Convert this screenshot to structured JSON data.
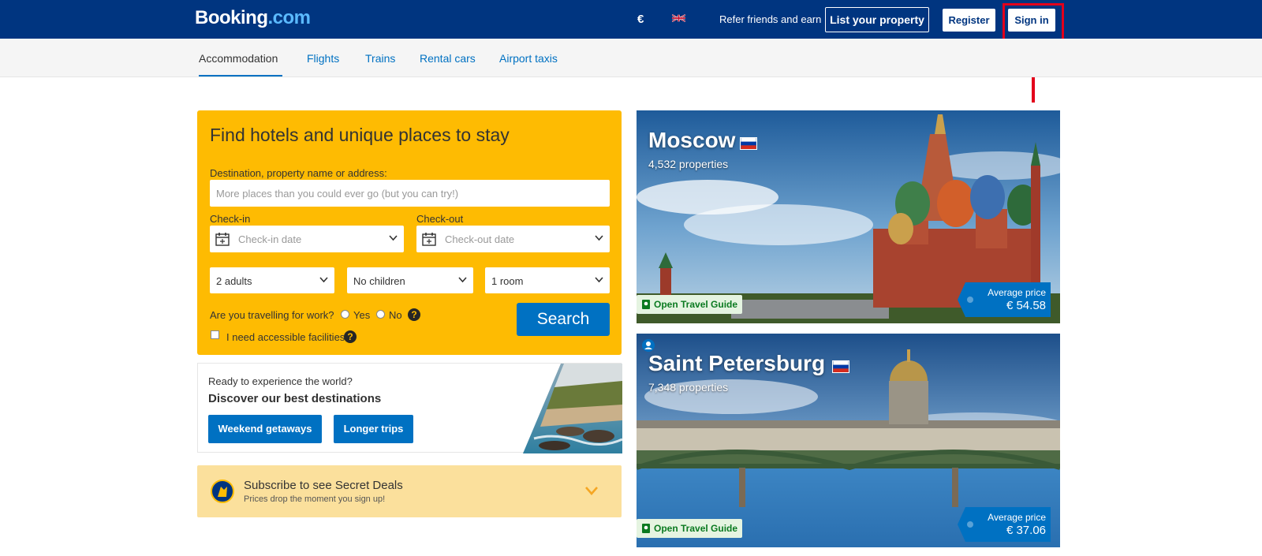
{
  "header": {
    "logo_main": "Booking",
    "logo_tld": ".com",
    "currency": "€",
    "language_flag": "uk-flag-icon",
    "refer": "Refer friends and earn",
    "list_property": "List your property",
    "register": "Register",
    "sign_in": "Sign in"
  },
  "nav": {
    "items": [
      "Accommodation",
      "Flights",
      "Trains",
      "Rental cars",
      "Airport taxis"
    ],
    "active": "Accommodation"
  },
  "search": {
    "title": "Find hotels and unique places to stay",
    "destination_label": "Destination, property name or address:",
    "destination_placeholder": "More places than you could ever go (but you can try!)",
    "checkin_label": "Check-in",
    "checkin_placeholder": "Check-in date",
    "checkout_label": "Check-out",
    "checkout_placeholder": "Check-out date",
    "adults": "2 adults",
    "children": "No children",
    "rooms": "1 room",
    "work_question": "Are you travelling for work?",
    "yes": "Yes",
    "no": "No",
    "accessible": "I need accessible facilities",
    "button": "Search"
  },
  "destinations": {
    "pre": "Ready to experience the world?",
    "title": "Discover our best destinations",
    "btn_weekend": "Weekend getaways",
    "btn_longer": "Longer trips"
  },
  "subscribe": {
    "title": "Subscribe to see Secret Deals",
    "text": "Prices drop the moment you sign up!"
  },
  "cities": [
    {
      "name": "Moscow",
      "properties": "4,532 properties",
      "guide": "Open Travel Guide",
      "price_label": "Average price",
      "price": "€ 54.58"
    },
    {
      "name": "Saint Petersburg",
      "properties": "7,348 properties",
      "guide": "Open Travel Guide",
      "price_label": "Average price",
      "price": "€ 37.06"
    }
  ],
  "colors": {
    "brand_blue": "#003580",
    "action_blue": "#0071c2",
    "search_yellow": "#febb02",
    "highlight_red": "#e3001b"
  }
}
